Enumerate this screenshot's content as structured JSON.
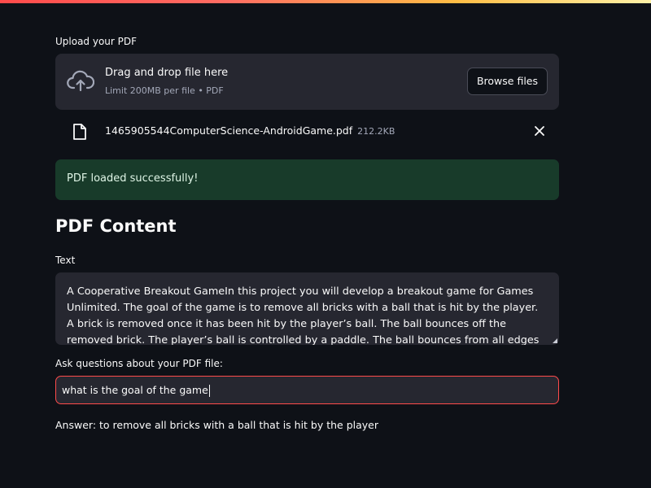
{
  "upload": {
    "label": "Upload your PDF",
    "dropzone_title": "Drag and drop file here",
    "dropzone_subtitle": "Limit 200MB per file • PDF",
    "browse_label": "Browse files",
    "file": {
      "name": "1465905544ComputerScience-AndroidGame.pdf",
      "size": "212.2KB"
    }
  },
  "status": {
    "success_message": "PDF loaded successfully!"
  },
  "content": {
    "heading": "PDF Content",
    "text_label": "Text",
    "text_value": "A Cooperative Breakout GameIn this project you will develop a breakout game for Games Unlimited. The goal of the game is to remove all bricks with a ball that is hit by the player. A brick is removed once it has been hit by the player’s ball. The ball bounces off the removed brick. The player’s ball is controlled by a paddle. The ball bounces from all edges but the lower edge. If the ball hits the lower"
  },
  "question": {
    "label": "Ask questions about your PDF file:",
    "value": "what is the goal of the game"
  },
  "answer": {
    "text": "Answer: to remove all bricks with a ball that is hit by the player"
  },
  "colors": {
    "background": "#0e1117",
    "panel": "#262730",
    "accent": "#ff4b4b",
    "success_bg": "#183b2a"
  },
  "icons": {
    "upload": "cloud-upload-icon",
    "file": "file-icon",
    "close": "close-icon"
  }
}
